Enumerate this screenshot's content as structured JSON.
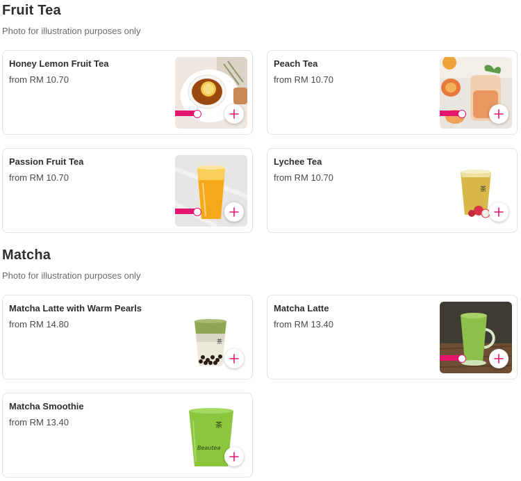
{
  "sections": [
    {
      "title": "Fruit Tea",
      "subtitle": "Photo for illustration purposes only",
      "items": [
        {
          "name": "Honey Lemon Fruit Tea",
          "price": "from RM 10.70"
        },
        {
          "name": "Peach Tea",
          "price": "from RM 10.70"
        },
        {
          "name": "Passion Fruit Tea",
          "price": "from RM 10.70"
        },
        {
          "name": "Lychee Tea",
          "price": "from RM 10.70"
        }
      ]
    },
    {
      "title": "Matcha",
      "subtitle": "Photo for illustration purposes only",
      "items": [
        {
          "name": "Matcha Latte with Warm Pearls",
          "price": "from RM 14.80"
        },
        {
          "name": "Matcha Latte",
          "price": "from RM 13.40"
        },
        {
          "name": "Matcha Smoothie",
          "price": "from RM 13.40"
        }
      ]
    }
  ],
  "icons": {
    "add": "plus-icon"
  },
  "colors": {
    "accent": "#e3156e",
    "card_border": "#e2e2e2",
    "text": "#2e2e2e",
    "muted": "#6b6b6b"
  }
}
